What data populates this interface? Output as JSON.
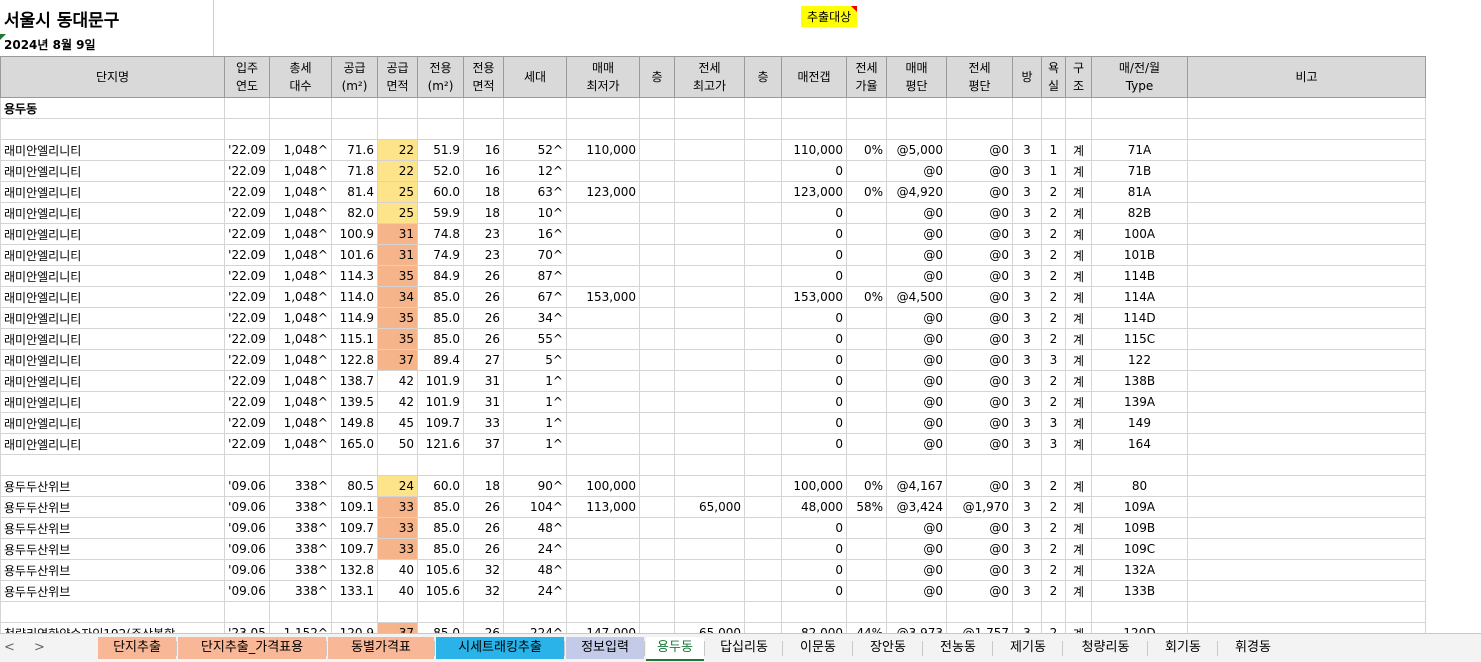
{
  "sheet": {
    "title": "서울시 동대문구",
    "date": "2024년 8월 9일",
    "tag": "추출대상"
  },
  "columns": [
    {
      "line1": "단지명",
      "line2": ""
    },
    {
      "line1": "입주",
      "line2": "연도"
    },
    {
      "line1": "총세",
      "line2": "대수"
    },
    {
      "line1": "공급",
      "line2": "(m²)"
    },
    {
      "line1": "공급",
      "line2": "면적"
    },
    {
      "line1": "전용",
      "line2": "(m²)"
    },
    {
      "line1": "전용",
      "line2": "면적"
    },
    {
      "line1": "세대",
      "line2": ""
    },
    {
      "line1": "매매",
      "line2": "최저가"
    },
    {
      "line1": "층",
      "line2": ""
    },
    {
      "line1": "전세",
      "line2": "최고가"
    },
    {
      "line1": "층",
      "line2": ""
    },
    {
      "line1": "매전갭",
      "line2": ""
    },
    {
      "line1": "전세",
      "line2": "가율"
    },
    {
      "line1": "매매",
      "line2": "평단"
    },
    {
      "line1": "전세",
      "line2": "평단"
    },
    {
      "line1": "방",
      "line2": ""
    },
    {
      "line1": "욕",
      "line2": "실"
    },
    {
      "line1": "구",
      "line2": "조"
    },
    {
      "line1": "매/전/월",
      "line2": "Type"
    },
    {
      "line1": "비고",
      "line2": ""
    }
  ],
  "section": "용두동",
  "rows": [
    [
      "",
      "",
      "",
      "",
      "",
      "",
      "",
      "",
      "",
      "",
      "",
      "",
      "",
      "",
      "",
      "",
      "",
      "",
      "",
      "",
      ""
    ],
    [
      "래미안엘리니티",
      "'22.09",
      "1,048^",
      "71.6",
      "22",
      "51.9",
      "16",
      "52^",
      "110,000",
      "",
      "",
      "",
      "110,000",
      "0%",
      "@5,000",
      "@0",
      "3",
      "1",
      "계",
      "71A",
      ""
    ],
    [
      "래미안엘리니티",
      "'22.09",
      "1,048^",
      "71.8",
      "22",
      "52.0",
      "16",
      "12^",
      "",
      "",
      "",
      "",
      "0",
      "",
      "@0",
      "@0",
      "3",
      "1",
      "계",
      "71B",
      ""
    ],
    [
      "래미안엘리니티",
      "'22.09",
      "1,048^",
      "81.4",
      "25",
      "60.0",
      "18",
      "63^",
      "123,000",
      "",
      "",
      "",
      "123,000",
      "0%",
      "@4,920",
      "@0",
      "3",
      "2",
      "계",
      "81A",
      ""
    ],
    [
      "래미안엘리니티",
      "'22.09",
      "1,048^",
      "82.0",
      "25",
      "59.9",
      "18",
      "10^",
      "",
      "",
      "",
      "",
      "0",
      "",
      "@0",
      "@0",
      "3",
      "2",
      "계",
      "82B",
      ""
    ],
    [
      "래미안엘리니티",
      "'22.09",
      "1,048^",
      "100.9",
      "31",
      "74.8",
      "23",
      "16^",
      "",
      "",
      "",
      "",
      "0",
      "",
      "@0",
      "@0",
      "3",
      "2",
      "계",
      "100A",
      ""
    ],
    [
      "래미안엘리니티",
      "'22.09",
      "1,048^",
      "101.6",
      "31",
      "74.9",
      "23",
      "70^",
      "",
      "",
      "",
      "",
      "0",
      "",
      "@0",
      "@0",
      "3",
      "2",
      "계",
      "101B",
      ""
    ],
    [
      "래미안엘리니티",
      "'22.09",
      "1,048^",
      "114.3",
      "35",
      "84.9",
      "26",
      "87^",
      "",
      "",
      "",
      "",
      "0",
      "",
      "@0",
      "@0",
      "3",
      "2",
      "계",
      "114B",
      ""
    ],
    [
      "래미안엘리니티",
      "'22.09",
      "1,048^",
      "114.0",
      "34",
      "85.0",
      "26",
      "67^",
      "153,000",
      "",
      "",
      "",
      "153,000",
      "0%",
      "@4,500",
      "@0",
      "3",
      "2",
      "계",
      "114A",
      ""
    ],
    [
      "래미안엘리니티",
      "'22.09",
      "1,048^",
      "114.9",
      "35",
      "85.0",
      "26",
      "34^",
      "",
      "",
      "",
      "",
      "0",
      "",
      "@0",
      "@0",
      "3",
      "2",
      "계",
      "114D",
      ""
    ],
    [
      "래미안엘리니티",
      "'22.09",
      "1,048^",
      "115.1",
      "35",
      "85.0",
      "26",
      "55^",
      "",
      "",
      "",
      "",
      "0",
      "",
      "@0",
      "@0",
      "3",
      "2",
      "계",
      "115C",
      ""
    ],
    [
      "래미안엘리니티",
      "'22.09",
      "1,048^",
      "122.8",
      "37",
      "89.4",
      "27",
      "5^",
      "",
      "",
      "",
      "",
      "0",
      "",
      "@0",
      "@0",
      "3",
      "3",
      "계",
      "122",
      ""
    ],
    [
      "래미안엘리니티",
      "'22.09",
      "1,048^",
      "138.7",
      "42",
      "101.9",
      "31",
      "1^",
      "",
      "",
      "",
      "",
      "0",
      "",
      "@0",
      "@0",
      "3",
      "2",
      "계",
      "138B",
      ""
    ],
    [
      "래미안엘리니티",
      "'22.09",
      "1,048^",
      "139.5",
      "42",
      "101.9",
      "31",
      "1^",
      "",
      "",
      "",
      "",
      "0",
      "",
      "@0",
      "@0",
      "3",
      "2",
      "계",
      "139A",
      ""
    ],
    [
      "래미안엘리니티",
      "'22.09",
      "1,048^",
      "149.8",
      "45",
      "109.7",
      "33",
      "1^",
      "",
      "",
      "",
      "",
      "0",
      "",
      "@0",
      "@0",
      "3",
      "3",
      "계",
      "149",
      ""
    ],
    [
      "래미안엘리니티",
      "'22.09",
      "1,048^",
      "165.0",
      "50",
      "121.6",
      "37",
      "1^",
      "",
      "",
      "",
      "",
      "0",
      "",
      "@0",
      "@0",
      "3",
      "3",
      "계",
      "164",
      ""
    ],
    [
      "",
      "",
      "",
      "",
      "",
      "",
      "",
      "",
      "",
      "",
      "",
      "",
      "",
      "",
      "",
      "",
      "",
      "",
      "",
      "",
      ""
    ],
    [
      "용두두산위브",
      "'09.06",
      "338^",
      "80.5",
      "24",
      "60.0",
      "18",
      "90^",
      "100,000",
      "",
      "",
      "",
      "100,000",
      "0%",
      "@4,167",
      "@0",
      "3",
      "2",
      "계",
      "80",
      ""
    ],
    [
      "용두두산위브",
      "'09.06",
      "338^",
      "109.1",
      "33",
      "85.0",
      "26",
      "104^",
      "113,000",
      "",
      "65,000",
      "",
      "48,000",
      "58%",
      "@3,424",
      "@1,970",
      "3",
      "2",
      "계",
      "109A",
      ""
    ],
    [
      "용두두산위브",
      "'09.06",
      "338^",
      "109.7",
      "33",
      "85.0",
      "26",
      "48^",
      "",
      "",
      "",
      "",
      "0",
      "",
      "@0",
      "@0",
      "3",
      "2",
      "계",
      "109B",
      ""
    ],
    [
      "용두두산위브",
      "'09.06",
      "338^",
      "109.7",
      "33",
      "85.0",
      "26",
      "24^",
      "",
      "",
      "",
      "",
      "0",
      "",
      "@0",
      "@0",
      "3",
      "2",
      "계",
      "109C",
      ""
    ],
    [
      "용두두산위브",
      "'09.06",
      "338^",
      "132.8",
      "40",
      "105.6",
      "32",
      "48^",
      "",
      "",
      "",
      "",
      "0",
      "",
      "@0",
      "@0",
      "3",
      "2",
      "계",
      "132A",
      ""
    ],
    [
      "용두두산위브",
      "'09.06",
      "338^",
      "133.1",
      "40",
      "105.6",
      "32",
      "24^",
      "",
      "",
      "",
      "",
      "0",
      "",
      "@0",
      "@0",
      "3",
      "2",
      "계",
      "133B",
      ""
    ],
    [
      "",
      "",
      "",
      "",
      "",
      "",
      "",
      "",
      "",
      "",
      "",
      "",
      "",
      "",
      "",
      "",
      "",
      "",
      "",
      "",
      ""
    ],
    [
      "청량리역한양수자인192(주상복합",
      "'23.05",
      "1,152^",
      "120.9",
      "37",
      "85.0",
      "26",
      "224^",
      "147,000",
      "",
      "65,000",
      "",
      "82,000",
      "44%",
      "@3,973",
      "@1,757",
      "3",
      "2",
      "계",
      "120D",
      ""
    ]
  ],
  "tabs": {
    "nav": [
      "<",
      ">"
    ],
    "items": [
      {
        "label": "단지추출",
        "color": "#f8b898",
        "active": false
      },
      {
        "label": "단지추출_가격표용",
        "color": "#f8b898",
        "active": false
      },
      {
        "label": "동별가격표",
        "color": "#f8b898",
        "active": false
      },
      {
        "label": "시세트래킹추출",
        "color": "#29b3e8",
        "active": false
      },
      {
        "label": "정보입력",
        "color": "#c4cbe8",
        "active": false
      },
      {
        "label": "용두동",
        "color": "#ffffff",
        "active": true
      },
      {
        "label": "답십리동",
        "color": "",
        "active": false
      },
      {
        "label": "이문동",
        "color": "",
        "active": false
      },
      {
        "label": "장안동",
        "color": "",
        "active": false
      },
      {
        "label": "전농동",
        "color": "",
        "active": false
      },
      {
        "label": "제기동",
        "color": "",
        "active": false
      },
      {
        "label": "청량리동",
        "color": "",
        "active": false
      },
      {
        "label": "회기동",
        "color": "",
        "active": false
      },
      {
        "label": "휘경동",
        "color": "",
        "active": false
      }
    ]
  }
}
